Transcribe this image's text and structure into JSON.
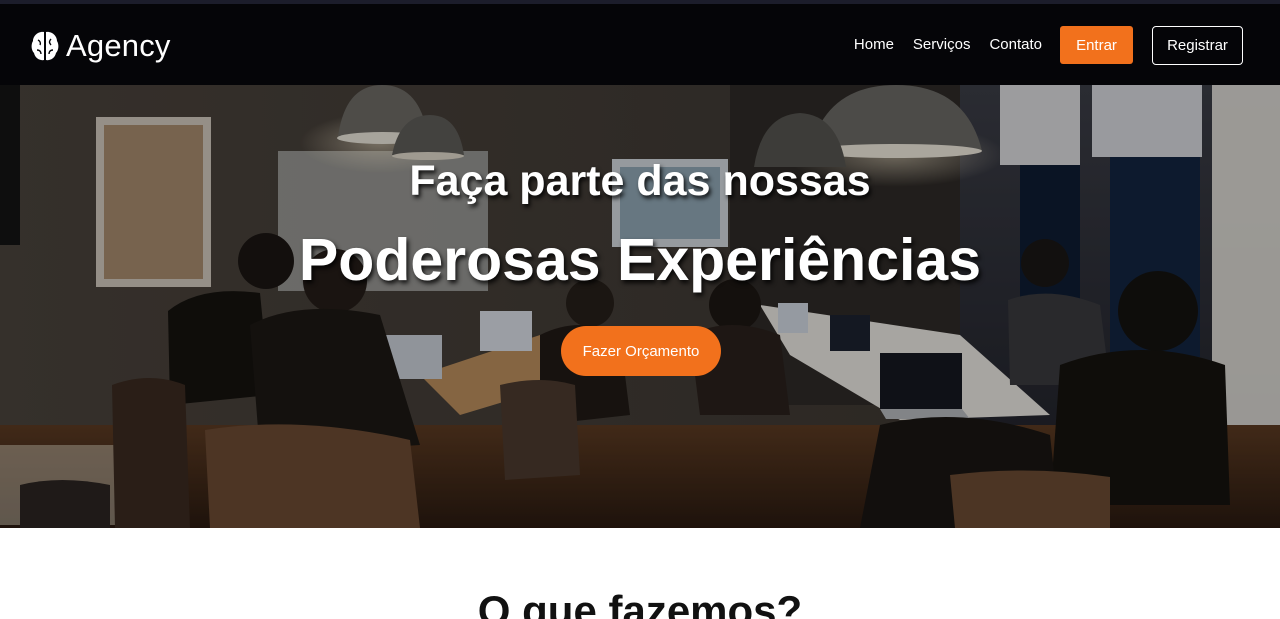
{
  "header": {
    "brand": {
      "name": "Agency",
      "icon": "brain-icon"
    },
    "nav": {
      "links": [
        "Home",
        "Serviços",
        "Contato"
      ],
      "login_label": "Entrar",
      "register_label": "Registrar"
    },
    "colors": {
      "background": "#050508",
      "accent": "#f2711c"
    }
  },
  "hero": {
    "line1": "Faça parte das nossas",
    "line2": "Poderosas Experiências",
    "cta_label": "Fazer Orçamento",
    "background_image": "team-meeting-photo"
  },
  "services": {
    "title": "O que fazemos?"
  }
}
